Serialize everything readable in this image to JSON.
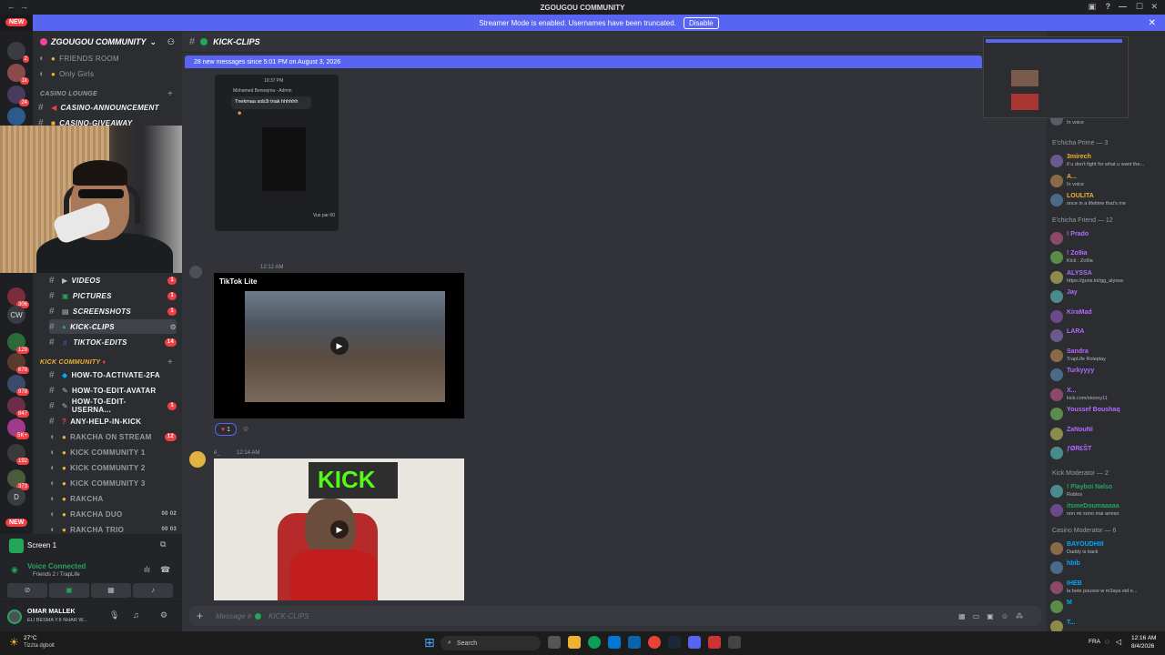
{
  "titlebar": {
    "title": "ZGOUGOU COMMUNITY"
  },
  "banner": {
    "text": "Streamer Mode is enabled. Usernames have been truncated.",
    "button": "Disable"
  },
  "rail": {
    "new_top": "NEW",
    "new_bottom": "NEW",
    "servers": [
      {
        "label": "",
        "badge": "2"
      },
      {
        "label": "",
        "badge": "1k"
      },
      {
        "label": "",
        "badge": "24"
      },
      {
        "label": "",
        "badge": ""
      },
      {
        "label": "",
        "badge": "306"
      },
      {
        "label": "CW",
        "badge": ""
      },
      {
        "label": "",
        "badge": "129"
      },
      {
        "label": "",
        "badge": "678"
      },
      {
        "label": "",
        "badge": "978"
      },
      {
        "label": "",
        "badge": "847"
      },
      {
        "label": "",
        "badge": "5K+"
      },
      {
        "label": "",
        "badge": "192"
      },
      {
        "label": "",
        "badge": "373"
      },
      {
        "label": "D",
        "badge": ""
      }
    ]
  },
  "sidebar": {
    "server_name": "ZGOUGOU COMMUNITY",
    "top_channels": [
      {
        "name": "FRIENDS ROOM"
      },
      {
        "name": "Only Girls"
      }
    ],
    "cat_casino": "CASINO LOUNGE",
    "casino_channels": [
      {
        "name": "CASINO-ANNOUNCEMENT"
      },
      {
        "name": "CASINO-GIVEAWAY"
      }
    ],
    "media_channels": [
      {
        "name": "VIDEOS",
        "count": "1"
      },
      {
        "name": "PICTURES",
        "count": "1"
      },
      {
        "name": "SCREENSHOTS",
        "count": "1"
      },
      {
        "name": "KICK-CLIPS",
        "count": ""
      },
      {
        "name": "TIKTOK-EDITS",
        "count": "14"
      }
    ],
    "cat_kick": "KICK COMMUNITY",
    "kick_channels": [
      {
        "name": "HOW-TO-ACTIVATE-2FA",
        "count": ""
      },
      {
        "name": "HOW-TO-EDIT-AVATAR",
        "count": ""
      },
      {
        "name": "HOW-TO-EDIT-USERNA...",
        "count": "1"
      },
      {
        "name": "ANY-HELP-IN-KICK",
        "count": ""
      },
      {
        "name": "RAKCHA ON STREAM",
        "count": "12"
      },
      {
        "name": "KICK COMMUNITY 1",
        "count": ""
      },
      {
        "name": "KICK COMMUNITY 2",
        "count": ""
      },
      {
        "name": "KICK COMMUNITY 3",
        "count": ""
      },
      {
        "name": "RAKCHA",
        "count": ""
      },
      {
        "name": "RAKCHA DUO",
        "pair": "00 02"
      },
      {
        "name": "RAKCHA TRIO",
        "pair": "00 03"
      }
    ]
  },
  "voice": {
    "screen_label": "Screen 1",
    "status": "Voice Connected",
    "channel": "Friends 2 / TrapLife"
  },
  "user": {
    "name": "OMAR MALLEK",
    "status": "ELI BESMA Y.II NHAR W..."
  },
  "chat": {
    "channel": "KICK-CLIPS",
    "new_messages": "28 new messages since 5:01 PM on August 3, 2026",
    "m1": {
      "time": "10:37 PM",
      "author": "Mohamed Bennejma - Admin",
      "text": "Tnekmaa sob3i tnak hhhhhh",
      "views": "Vus par 60"
    },
    "m2": {
      "time": "12:12 AM",
      "tiktok": "TikTok Lite",
      "reaction": "1"
    },
    "m3": {
      "author": "é_",
      "time": "12:14 AM",
      "sign": "KICK"
    },
    "composer_placeholder": "Message #",
    "composer_channel": "KICK-CLIPS"
  },
  "members": {
    "groups": [
      {
        "title": "E'chicha Prime — 3",
        "members": [
          {
            "name": "3mirech",
            "status": "if u don't fight for what u want the...",
            "color": "#f0b232"
          },
          {
            "name": "A...",
            "status": "In voice",
            "color": "#f0b232"
          },
          {
            "name": "LOULITA",
            "status": "once in a lifetime that's me",
            "color": "#f0b232"
          }
        ]
      },
      {
        "title": "E'chicha Friend — 12",
        "members": [
          {
            "name": "! Prado",
            "status": "",
            "color": "#b36bff"
          },
          {
            "name": "! Zo9ia",
            "status": "Kick : Zo9ia",
            "color": "#b36bff"
          },
          {
            "name": "ALYSSA",
            "status": "https://guns.lol/gg_alyssa",
            "color": "#b36bff"
          },
          {
            "name": "Jay",
            "status": "",
            "color": "#b36bff"
          },
          {
            "name": "KiraMad",
            "status": "",
            "color": "#b36bff"
          },
          {
            "name": "LARA",
            "status": "",
            "color": "#b36bff"
          },
          {
            "name": "Sandra",
            "status": "TrapLife Roleplay",
            "color": "#b36bff"
          },
          {
            "name": "Turkyyyy",
            "status": "",
            "color": "#b36bff"
          },
          {
            "name": "X...",
            "status": "kick.com/xtoony11",
            "color": "#b36bff"
          },
          {
            "name": "Youssef Boushaq",
            "status": "",
            "color": "#b36bff"
          },
          {
            "name": "ZaNouNi",
            "status": "",
            "color": "#b36bff"
          },
          {
            "name": "ƒØR£ŠT",
            "status": "",
            "color": "#b36bff"
          }
        ]
      },
      {
        "title": "Kick Moderator — 2",
        "members": [
          {
            "name": "! Playboi Nalso",
            "status": "Roblox",
            "color": "#23a55a"
          },
          {
            "name": "itsmeDoumaaaaa",
            "status": "non mi sono mai arreso",
            "color": "#23a55a"
          }
        ]
      },
      {
        "title": "Casino Moderator — 6",
        "members": [
          {
            "name": "BAYOUDHIII",
            "status": "Daddy is back",
            "color": "#00a8fc"
          },
          {
            "name": "hbib",
            "status": "",
            "color": "#00a8fc"
          },
          {
            "name": "IHEB",
            "status": "la bete pousse w m3aya eid e...",
            "color": "#00a8fc"
          },
          {
            "name": "M",
            "status": "",
            "color": "#00a8fc"
          },
          {
            "name": "T...",
            "status": "",
            "color": "#00a8fc"
          }
        ]
      }
    ],
    "top_partial": {
      "name": "namarenge",
      "status": "In voice"
    }
  },
  "taskbar": {
    "weather_temp": "27°C",
    "weather_desc": "Tizzta dgbolt",
    "search": "Search",
    "lang": "FRA",
    "time": "12:16 AM",
    "date": "8/4/2026"
  }
}
